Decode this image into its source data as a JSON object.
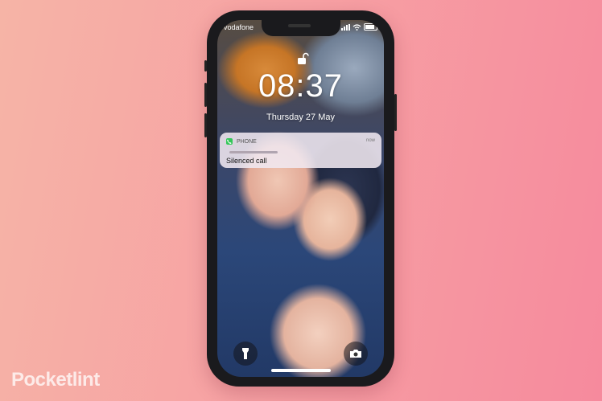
{
  "status_bar": {
    "carrier": "vodafone"
  },
  "lock_screen": {
    "time": "08:37",
    "date": "Thursday 27 May"
  },
  "notification": {
    "app_name": "PHONE",
    "time_label": "now",
    "title": "Silenced call",
    "app_icon": "phone-icon"
  },
  "quick_actions": {
    "left": "flashlight-icon",
    "right": "camera-icon"
  },
  "watermark": "Pocketlint",
  "colors": {
    "background_start": "#f6b4a6",
    "background_end": "#f68a9d",
    "phone_frame": "#1a1a1d",
    "notification_bg": "#f0e8f0"
  }
}
